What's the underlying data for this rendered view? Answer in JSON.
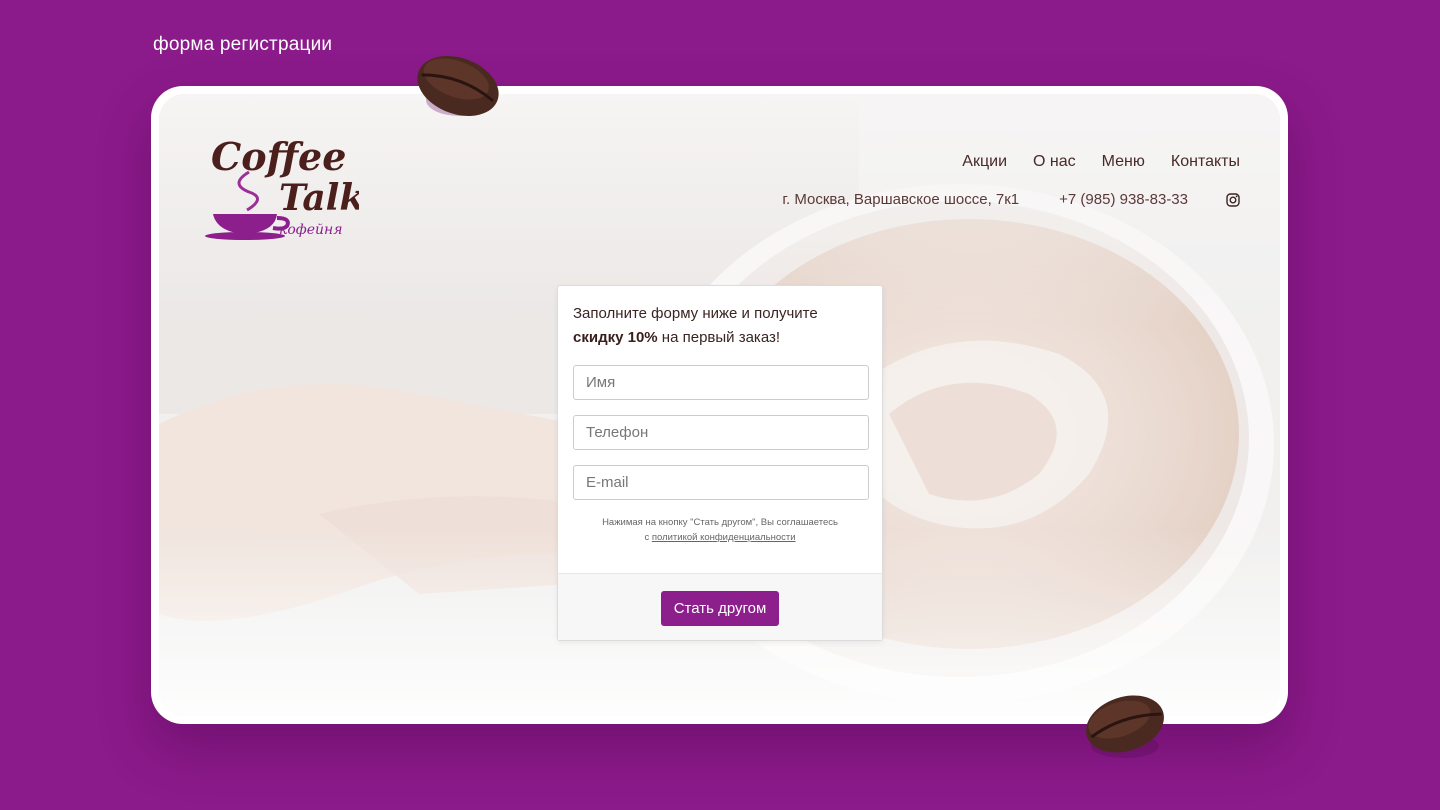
{
  "caption": "форма регистрации",
  "brand": {
    "logo_line1": "Coffee &",
    "logo_line2": "Talk",
    "logo_sub": "кофейня"
  },
  "nav": {
    "items": [
      {
        "label": "Акции"
      },
      {
        "label": "О нас"
      },
      {
        "label": "Меню"
      },
      {
        "label": "Контакты"
      }
    ]
  },
  "contacts": {
    "address": "г. Москва, Варшавское шоссе, 7к1",
    "phone": "+7 (985) 938-83-33",
    "social_icon": "instagram-icon"
  },
  "form": {
    "title_line1": "Заполните форму ниже и получите",
    "title_bold": "скидку 10%",
    "title_tail": " на первый заказ!",
    "name_placeholder": "Имя",
    "phone_placeholder": "Телефон",
    "email_placeholder": "E-mail",
    "agree_line1": "Нажимая на кнопку \"Стать другом\", Вы соглашаетесь",
    "agree_prefix": "с ",
    "agree_link": "политикой конфиденциальности",
    "submit_label": "Стать другом"
  },
  "colors": {
    "page_bg": "#8b1a8a",
    "accent": "#8c1f8c",
    "brown_text": "#4a2a28"
  }
}
